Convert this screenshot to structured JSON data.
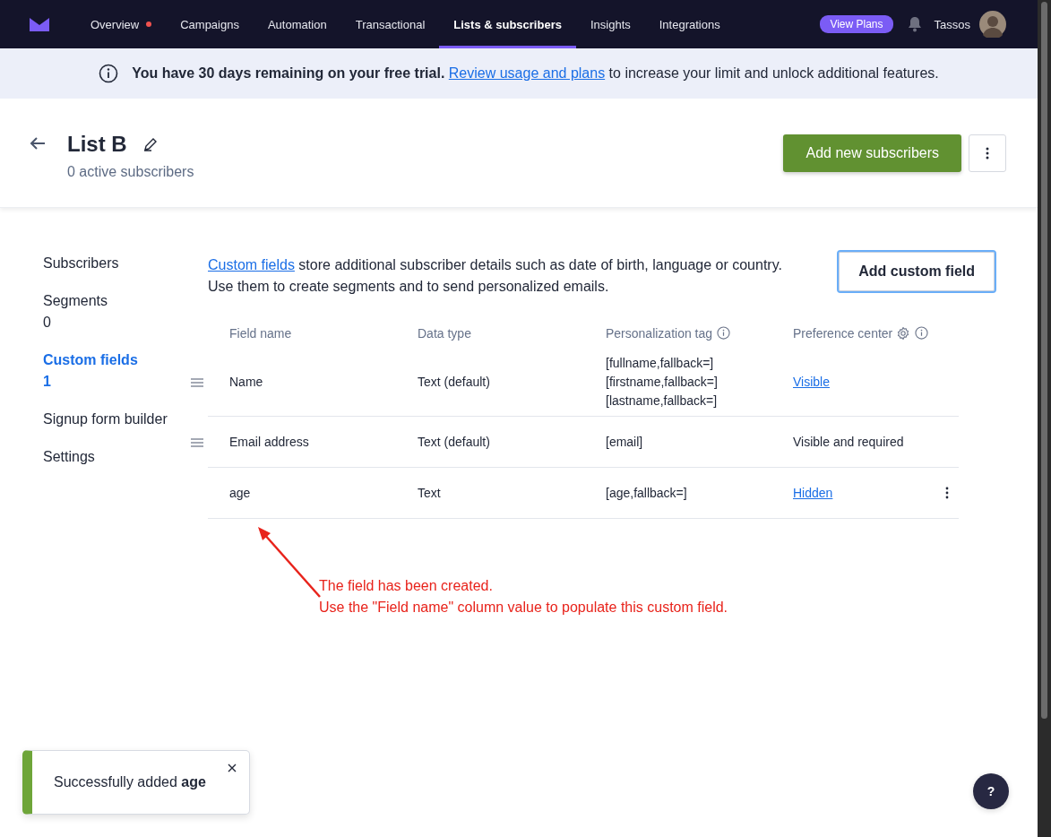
{
  "nav": {
    "items": [
      {
        "label": "Overview",
        "selected": false,
        "dot": true
      },
      {
        "label": "Campaigns",
        "selected": false,
        "dot": false
      },
      {
        "label": "Automation",
        "selected": false,
        "dot": false
      },
      {
        "label": "Transactional",
        "selected": false,
        "dot": false
      },
      {
        "label": "Lists & subscribers",
        "selected": true,
        "dot": false
      },
      {
        "label": "Insights",
        "selected": false,
        "dot": false
      },
      {
        "label": "Integrations",
        "selected": false,
        "dot": false
      }
    ],
    "view_plans": "View Plans",
    "user": "Tassos"
  },
  "banner": {
    "text": "**You have 30 days remaining on your free trial.**",
    "link": "Review usage and plans",
    "rest": "to increase your limit and unlock additional features."
  },
  "header": {
    "title": "List B",
    "subtitle": "0 active subscribers",
    "primary_button": "Add new subscribers"
  },
  "sidebar": {
    "items": [
      {
        "label": "Subscribers",
        "selected": false
      },
      {
        "label": "Segments",
        "count": "0",
        "selected": false
      },
      {
        "label": "Custom fields",
        "count": "1",
        "selected": true
      },
      {
        "label": "Signup form builder",
        "selected": false
      },
      {
        "label": "Settings",
        "selected": false
      }
    ]
  },
  "intro": {
    "link": "Custom fields",
    "lines": [
      "store additional subscriber details such as date of birth, language or country.",
      "Use them to create segments and to send personalized emails."
    ]
  },
  "add_button": "Add custom field",
  "table": {
    "columns": [
      {
        "label": "Field name",
        "info": false,
        "settings": false
      },
      {
        "label": "Data type",
        "info": false,
        "settings": false
      },
      {
        "label": "Personalization tag",
        "info": true,
        "settings": false
      },
      {
        "label": "Preference center",
        "info": true,
        "settings": true
      }
    ],
    "rows": [
      {
        "field_name": "Name",
        "data_type": "Text (default)",
        "tags": [
          "[fullname,fallback=]",
          "[firstname,fallback=]",
          "[lastname,fallback=]"
        ],
        "preference": "Visible",
        "kind": "link",
        "draggable": true,
        "menu": false
      },
      {
        "field_name": "Email address",
        "data_type": "Text (default)",
        "tags": [
          "[email]"
        ],
        "preference": "Visible and required",
        "kind": "text",
        "draggable": true,
        "menu": false
      },
      {
        "field_name": "age",
        "data_type": "Text",
        "tags": [
          "[age,fallback=]"
        ],
        "preference": "Hidden",
        "kind": "link",
        "draggable": false,
        "menu": true
      }
    ]
  },
  "annotation": {
    "lines": [
      "The field has been created.",
      "Use the \"Field name\" column value to populate this custom field."
    ]
  },
  "toast": {
    "text": "Successfully added **age**"
  },
  "help_button": "?"
}
